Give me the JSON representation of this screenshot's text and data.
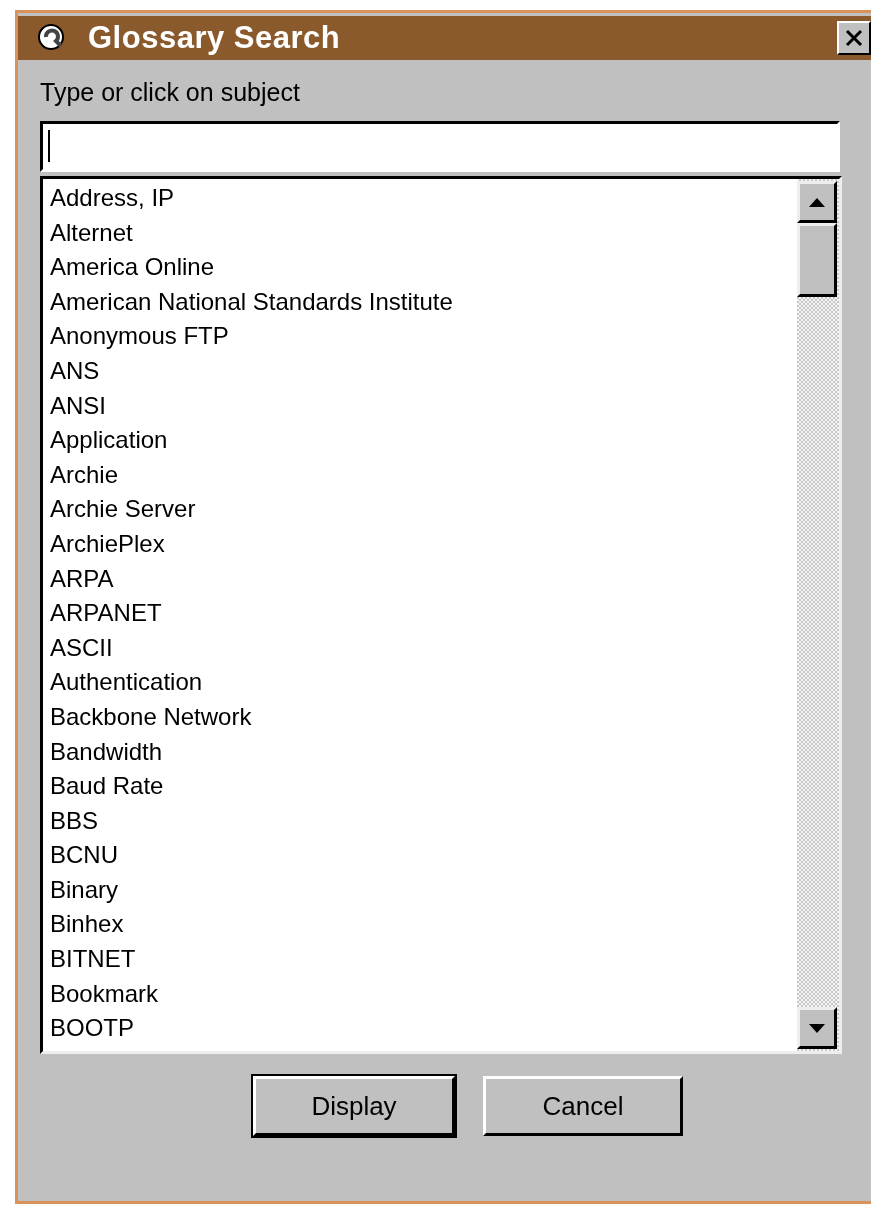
{
  "window": {
    "title": "Glossary Search"
  },
  "prompt": "Type or click on subject",
  "list": {
    "items": [
      "Address, IP",
      "Alternet",
      "America Online",
      "American National Standards Institute",
      "Anonymous FTP",
      "ANS",
      "ANSI",
      "Application",
      "Archie",
      "Archie Server",
      "ArchiePlex",
      "ARPA",
      "ARPANET",
      "ASCII",
      "Authentication",
      "Backbone Network",
      "Bandwidth",
      "Baud Rate",
      "BBS",
      "BCNU",
      "Binary",
      "Binhex",
      "BITNET",
      "Bookmark",
      "BOOTP"
    ]
  },
  "buttons": [
    {
      "label": "Display",
      "default": true
    },
    {
      "label": "Cancel",
      "default": false
    }
  ]
}
